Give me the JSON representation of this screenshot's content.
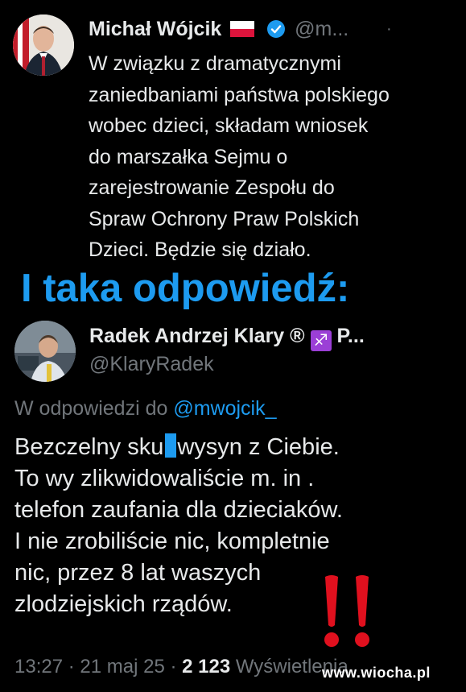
{
  "tweet1": {
    "author_name": "Michał Wójcik",
    "handle": "@m...",
    "dot": "·",
    "body": "W związku z dramatycznymi\nzaniedbaniami państwa polskiego\nwobec dzieci, składam wniosek\ndo marszałka Sejmu o\nzarejestrowanie Zespołu do\nSpraw Ochrony Praw Polskich\nDzieci. Będzie się działo."
  },
  "overlay_caption": "I taka odpowiedź:",
  "tweet2": {
    "author_name": "Radek Andrzej Klary ®",
    "author_suffix": "P...",
    "badge_symbol": "♐",
    "handle": "@KlaryRadek",
    "reply_prefix": "W odpowiedzi do",
    "reply_mention": "@mwojcik_",
    "line1_a": "Bezczelny sku",
    "line1_b": "wysyn z Ciebie.",
    "line2": "To wy zlikwidowaliście m. in .",
    "line3": "telefon zaufania dla dzieciaków.",
    "line4": "I nie zrobiliście nic, kompletnie",
    "line5": "nic, przez 8 lat waszych",
    "line6": "zlodziejskich rządów.",
    "meta_time": "13:27 · 21 maj 25 · ",
    "meta_views": "2 123",
    "meta_views_label": " Wyświetlenia"
  },
  "watermark": "www.wiocha.pl",
  "colors": {
    "background": "#000000",
    "text": "#e7e9ea",
    "muted": "#71767b",
    "accent": "#1d9bf0",
    "exclamation": "#e0101e"
  }
}
